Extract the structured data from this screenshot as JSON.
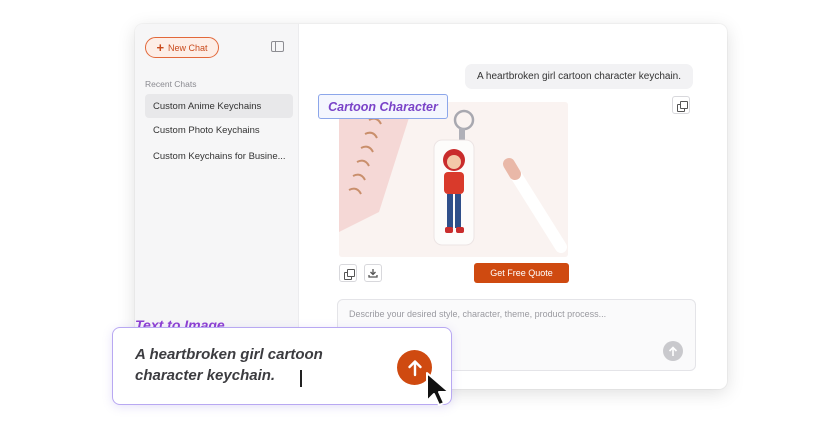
{
  "sidebar": {
    "new_chat_label": "New Chat",
    "recent_label": "Recent Chats",
    "items": [
      {
        "label": "Custom Anime Keychains",
        "active": true
      },
      {
        "label": "Custom Photo Keychains",
        "active": false
      },
      {
        "label": "Custom Keychains for Busine...",
        "active": false
      }
    ]
  },
  "chat": {
    "user_message": "A heartbroken girl cartoon character keychain.",
    "image_tag": "Cartoon Character",
    "quote_button": "Get Free Quote",
    "input_placeholder": "Describe your desired style, character, theme, product process..."
  },
  "overlay": {
    "title": "Text to Image",
    "prompt_line1": "A heartbroken girl cartoon",
    "prompt_line2": "character keychain."
  },
  "colors": {
    "accent": "#cf4a10",
    "tag_text": "#7a43c8",
    "sidebar_bg": "#f6f6f7"
  },
  "icons": [
    "plus-icon",
    "sidebar-toggle-icon",
    "copy-icon",
    "download-icon",
    "arrow-up-icon",
    "mouse-cursor-icon"
  ]
}
